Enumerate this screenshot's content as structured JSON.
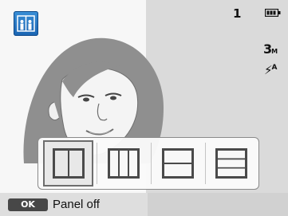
{
  "status": {
    "shot_count": "1",
    "resolution_value": "3",
    "resolution_unit": "M",
    "flash_label": "A"
  },
  "icons": {
    "mode": "split-shot-mode-icon",
    "battery": "battery-full-icon",
    "flash": "flash-auto-icon"
  },
  "panel": {
    "options": [
      {
        "name": "split-2-vertical",
        "selected": true
      },
      {
        "name": "split-3-vertical",
        "selected": false
      },
      {
        "name": "split-2-horizontal",
        "selected": false
      },
      {
        "name": "split-3-horizontal",
        "selected": false
      }
    ]
  },
  "footer": {
    "ok_key": "OK",
    "panel_off_label": "Panel off"
  },
  "colors": {
    "mode_icon_blue": "#1b64b2",
    "panel_icon": "#4a4a4a",
    "ok_key": "#474747"
  }
}
